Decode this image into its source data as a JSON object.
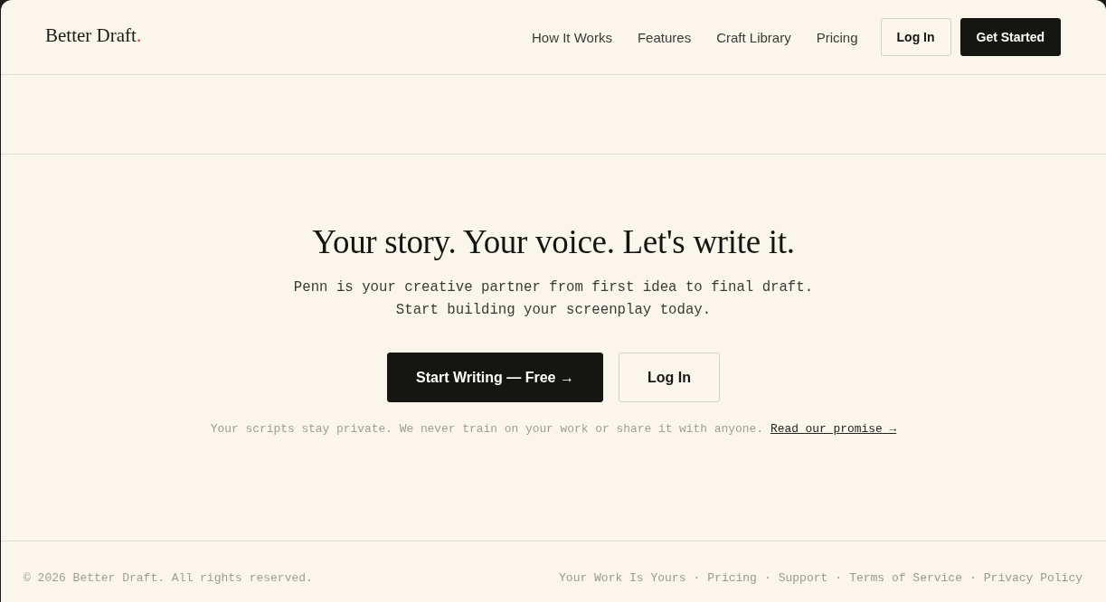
{
  "header": {
    "logo": {
      "text": "Better Draft",
      "dot": "."
    },
    "nav": [
      "How It Works",
      "Features",
      "Craft Library",
      "Pricing"
    ],
    "buttons": [
      {
        "label": "Log In",
        "kind": "outline"
      },
      {
        "label": "Get Started",
        "kind": "solid"
      }
    ]
  },
  "hero": {
    "headline": "Your story. Your voice. Let's write it.",
    "subtitle": "Penn is your creative partner from first idea to final draft. Start building your screenplay today.",
    "buttons": [
      {
        "label": "Start Writing — Free →",
        "kind": "solid"
      },
      {
        "label": "Log In",
        "kind": "outline"
      }
    ],
    "note": {
      "text": "Your scripts stay private. We never train on your work or share it with anyone.",
      "link": "Read our promise →"
    }
  },
  "footer": {
    "copyright": "© 2026 Better Draft. All rights reserved.",
    "links": [
      "Your Work Is Yours",
      "Pricing",
      "Support",
      "Terms of Service",
      "Privacy Policy"
    ],
    "separator": "·"
  }
}
